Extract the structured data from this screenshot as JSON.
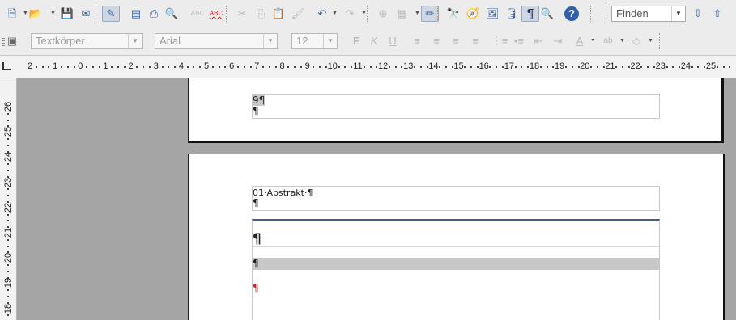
{
  "toolbar_standard": {
    "buttons": [
      {
        "name": "new-document-icon",
        "glyph": "🗎",
        "dropdown": true
      },
      {
        "name": "open-icon",
        "glyph": "📂",
        "dropdown": true
      },
      {
        "name": "save-icon",
        "glyph": "💾"
      },
      {
        "name": "email-icon",
        "glyph": "✉"
      },
      {
        "name": "edit-file-icon",
        "glyph": "✎",
        "active": true
      },
      {
        "name": "export-pdf-icon",
        "glyph": "▤"
      },
      {
        "name": "print-icon",
        "glyph": "⎙"
      },
      {
        "name": "page-preview-icon",
        "glyph": "🔍"
      },
      {
        "name": "spellcheck-icon",
        "glyph": "ABC",
        "disabled": true
      },
      {
        "name": "autospellcheck-icon",
        "glyph": "ABC"
      },
      {
        "name": "cut-icon",
        "glyph": "✂",
        "disabled": true
      },
      {
        "name": "copy-icon",
        "glyph": "⎘",
        "disabled": true
      },
      {
        "name": "paste-icon",
        "glyph": "📋",
        "disabled": true
      },
      {
        "name": "format-paintbrush-icon",
        "glyph": "🖌",
        "disabled": true
      },
      {
        "name": "undo-icon",
        "glyph": "↶",
        "dropdown": true
      },
      {
        "name": "redo-icon",
        "glyph": "↷",
        "dropdown": true,
        "disabled": true
      },
      {
        "name": "hyperlink-icon",
        "glyph": "⊕",
        "disabled": true
      },
      {
        "name": "table-icon",
        "glyph": "▦",
        "dropdown": true,
        "disabled": true
      },
      {
        "name": "show-draw-functions-icon",
        "glyph": "✏",
        "active": true
      },
      {
        "name": "find-replace-icon",
        "glyph": "🔭"
      },
      {
        "name": "navigator-icon",
        "glyph": "🧭"
      },
      {
        "name": "gallery-icon",
        "glyph": "🖼"
      },
      {
        "name": "data-sources-icon",
        "glyph": "🛢"
      },
      {
        "name": "formatting-marks-icon",
        "glyph": "¶",
        "active": true
      },
      {
        "name": "zoom-icon",
        "glyph": "🔍"
      },
      {
        "name": "help-icon",
        "glyph": "?"
      }
    ],
    "find_placeholder": "Finden",
    "find_next_glyph": "⇩",
    "find_prev_glyph": "⇧"
  },
  "toolbar_formatting": {
    "styles_icon_glyph": "▣",
    "paragraph_style": "Textkörper",
    "font_name": "Arial",
    "font_size": "12",
    "bold_glyph": "F",
    "italic_glyph": "K",
    "underline_glyph": "U",
    "extra_glyphs": [
      "≡",
      "≡",
      "≡",
      "≡",
      "⋮≡",
      "•≡",
      "⇤",
      "⇥",
      "A",
      "ab",
      "◇"
    ]
  },
  "ruler": {
    "horizontal_labels": [
      "2",
      "1",
      "0",
      "1",
      "2",
      "3",
      "4",
      "5",
      "6",
      "7",
      "8",
      "9",
      "10",
      "11",
      "12",
      "13",
      "14",
      "15",
      "16",
      "17",
      "18",
      "19",
      "20",
      "21",
      "22",
      "23",
      "24",
      "25"
    ],
    "vertical_labels": [
      "26",
      "25",
      "24",
      "23",
      "22",
      "21",
      "20",
      "19",
      "18"
    ]
  },
  "document": {
    "page1_footer_line1": "9¶",
    "page1_footer_line2": "¶",
    "page2_header_line1": "01·Abstrakt·¶",
    "page2_header_line2": "¶",
    "body_para1": "¶",
    "body_para2": "¶",
    "body_para3": "¶",
    "colors": {
      "highlight": "#c8c8c8",
      "red_mark": "#d42020",
      "header_line": "#4a5a8a"
    }
  }
}
